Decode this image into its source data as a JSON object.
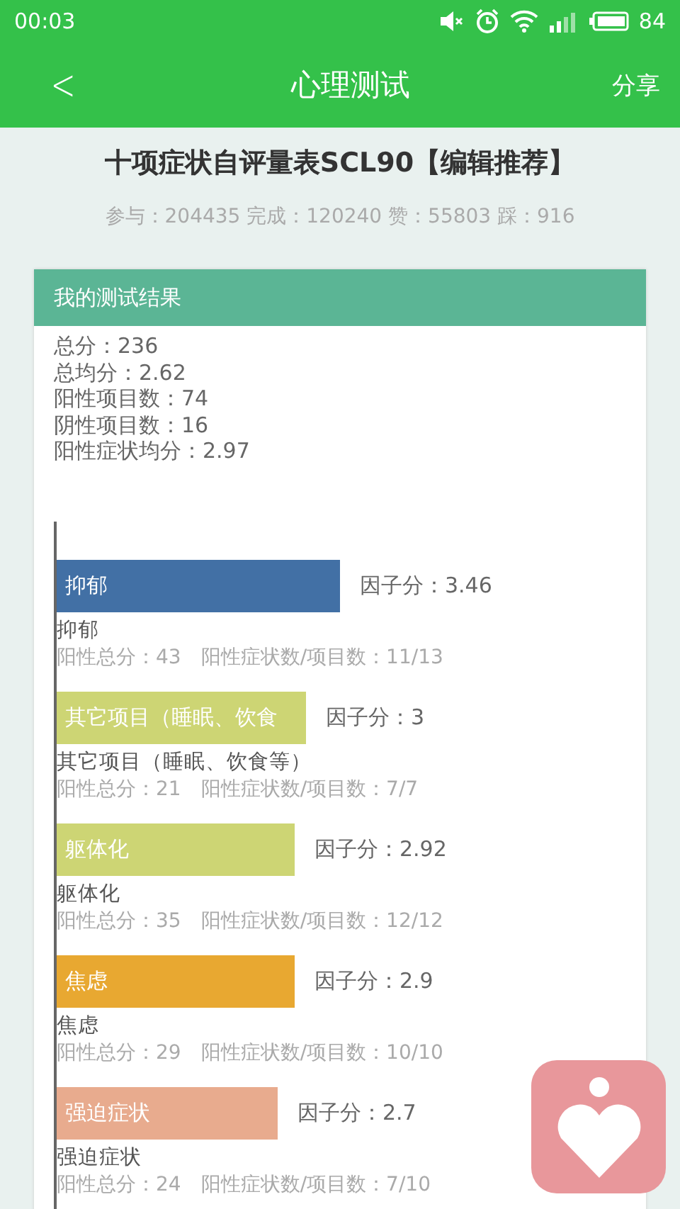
{
  "status_bar": {
    "time": "00:03",
    "battery": "84"
  },
  "header": {
    "back": "<",
    "title": "心理测试",
    "action": "分享"
  },
  "test": {
    "title": "十项症状自评量表SCL90【编辑推荐】",
    "stats": "参与：204435 完成：120240 赞：55803 踩：916"
  },
  "result": {
    "heading": "我的测试结果",
    "summary": [
      "总分：236",
      "总均分：2.62",
      "阳性项目数：74",
      "阴性项目数：16",
      "阳性症状均分：2.97"
    ],
    "factors": [
      {
        "bar_label": "抑郁",
        "score": "因子分：3.46",
        "name": "抑郁",
        "detail": "阳性总分：43　阳性症状数/项目数：11/13",
        "color": "#4270a5"
      },
      {
        "bar_label": "其它项目（睡眠、饮食",
        "score": "因子分：3",
        "name": "其它项目（睡眠、饮食等）",
        "detail": "阳性总分：21　阳性症状数/项目数：7/7",
        "color": "#cdd574"
      },
      {
        "bar_label": "躯体化",
        "score": "因子分：2.92",
        "name": "躯体化",
        "detail": "阳性总分：35　阳性症状数/项目数：12/12",
        "color": "#cdd574"
      },
      {
        "bar_label": "焦虑",
        "score": "因子分：2.9",
        "name": "焦虑",
        "detail": "阳性总分：29　阳性症状数/项目数：10/10",
        "color": "#e8a831"
      },
      {
        "bar_label": "强迫症状",
        "score": "因子分：2.7",
        "name": "强迫症状",
        "detail": "阳性总分：24　阳性症状数/项目数：7/10",
        "color": "#e8ab8e"
      }
    ]
  }
}
